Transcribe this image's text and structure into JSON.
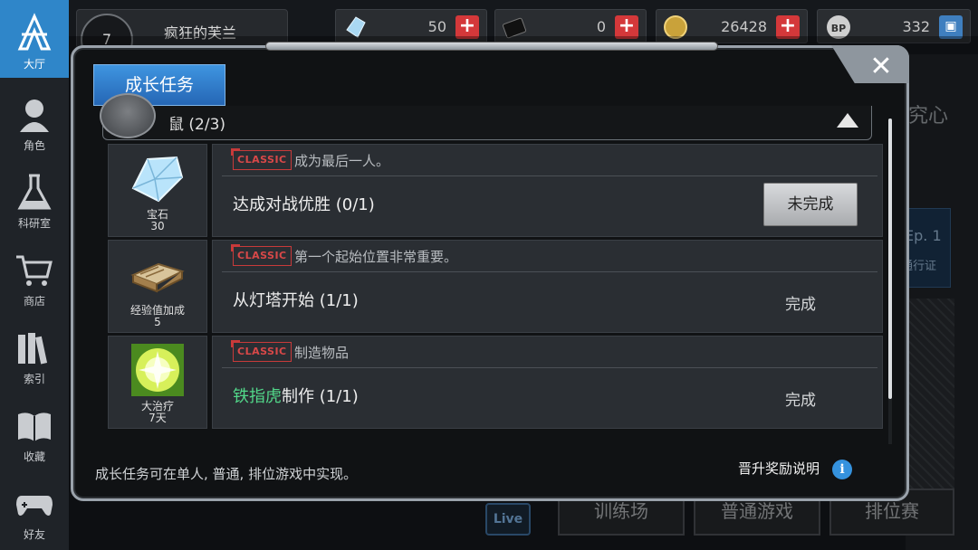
{
  "sidebar": {
    "items": [
      {
        "label": "大厅",
        "icon": "lobby-logo-icon",
        "active": true
      },
      {
        "label": "角色",
        "icon": "character-icon"
      },
      {
        "label": "科研室",
        "icon": "flask-icon"
      },
      {
        "label": "商店",
        "icon": "cart-icon"
      },
      {
        "label": "索引",
        "icon": "books-icon"
      },
      {
        "label": "收藏",
        "icon": "book-icon"
      },
      {
        "label": "好友",
        "icon": "gamepad-icon"
      }
    ]
  },
  "player": {
    "level": "7",
    "name": "疯狂的芙兰"
  },
  "currencies": [
    {
      "icon": "crystal-icon",
      "value": "50"
    },
    {
      "icon": "black-card-icon",
      "value": "0"
    },
    {
      "icon": "gold-coin-icon",
      "value": "26428"
    },
    {
      "icon": "bp-paw-icon",
      "value": "332"
    }
  ],
  "background": {
    "side_text": "究心",
    "battle_pass": {
      "ep": "Ep. 1",
      "label": "通行证"
    },
    "bottom_buttons": [
      "训练场",
      "普通游戏",
      "排位赛"
    ],
    "live_label": "Live"
  },
  "modal": {
    "title": "成长任务",
    "category_label": "鼠 (2/3)",
    "missions": [
      {
        "reward_name": "宝石",
        "reward_qty": "30",
        "reward_icon": "gem-icon",
        "tag": "CLASSIC",
        "hint": "成为最后一人。",
        "goal": "达成对战优胜 (0/1)",
        "goal_highlight": "",
        "status": "未完成",
        "status_type": "button"
      },
      {
        "reward_name": "经验值加成",
        "reward_qty": "5",
        "reward_icon": "exp-book-icon",
        "tag": "CLASSIC",
        "hint": "第一个起始位置非常重要。",
        "goal": "从灯塔开始 (1/1)",
        "goal_highlight": "",
        "status": "完成",
        "status_type": "text"
      },
      {
        "reward_name": "大治疗",
        "reward_qty": "7天",
        "reward_icon": "heal-orb-icon",
        "tag": "CLASSIC",
        "hint": "制造物品",
        "goal": "制作 (1/1)",
        "goal_highlight": "铁指虎",
        "status": "完成",
        "status_type": "text"
      }
    ],
    "footer_note": "成长任务可在单人, 普通, 排位游戏中实现。",
    "promo_link": "晋升奖励说明",
    "info_glyph": "i",
    "close_glyph": "✕"
  }
}
